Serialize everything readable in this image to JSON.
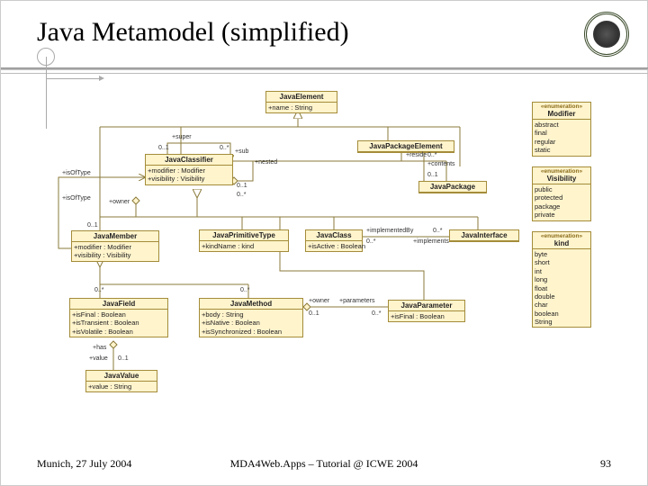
{
  "title": "Java Metamodel (simplified)",
  "footer": {
    "left": "Munich, 27 July 2004",
    "mid": "MDA4Web.Apps – Tutorial @ ICWE 2004",
    "page": "93"
  },
  "classes": {
    "JavaElement": {
      "name": "JavaElement",
      "attrs": "+name : String"
    },
    "JavaPackageElement": {
      "name": "JavaPackageElement"
    },
    "JavaClassifier": {
      "name": "JavaClassifier",
      "attrs": "+modifier : Modifier\n+visibility : Visibility"
    },
    "JavaPackage": {
      "name": "JavaPackage"
    },
    "JavaMember": {
      "name": "JavaMember",
      "attrs": "+modifier : Modifier\n+visibility : Visibility"
    },
    "JavaPrimitiveType": {
      "name": "JavaPrimitiveType",
      "attrs": "+kindName : kind"
    },
    "JavaClass": {
      "name": "JavaClass",
      "attrs": "+isActive : Boolean"
    },
    "JavaInterface": {
      "name": "JavaInterface"
    },
    "JavaField": {
      "name": "JavaField",
      "attrs": "+isFinal : Boolean\n+isTransient : Boolean\n+isVolatile : Boolean"
    },
    "JavaMethod": {
      "name": "JavaMethod",
      "attrs": "+body : String\n+isNative : Boolean\n+isSynchronized : Boolean"
    },
    "JavaParameter": {
      "name": "JavaParameter",
      "attrs": "+isFinal : Boolean"
    },
    "JavaValue": {
      "name": "JavaValue",
      "attrs": "+value : String"
    }
  },
  "enums": {
    "Modifier": {
      "stereo": "«enumeration»",
      "name": "Modifier",
      "lits": "abstract\nfinal\nregular\nstatic"
    },
    "Visibility": {
      "stereo": "«enumeration»",
      "name": "Visibility",
      "lits": "public\nprotected\npackage\nprivate"
    },
    "kind": {
      "stereo": "«enumeration»",
      "name": "kind",
      "lits": "byte\nshort\nint\nlong\nfloat\ndouble\nchar\nboolean\nString"
    }
  },
  "labels": {
    "super": "+super",
    "sub": "+sub",
    "zeroOne_a": "0..1",
    "zeroStar_a": "0..*",
    "nested": "+nested",
    "isOfType1": "+isOfType",
    "isOfType2": "+isOfType",
    "reside": "+reside",
    "contents": "+contents",
    "zeroStar_b": "0..*",
    "zeroOne_b": "0..1",
    "owner": "+owner",
    "implementedBy": "+implementedBy",
    "implements": "+implements",
    "zs_impl1": "0..*",
    "zs_impl2": "0..*",
    "zeroOne_c": "0..1",
    "zeroStar_c": "0..*",
    "zeroStar_d": "0..*",
    "zeroStar_e": "0..*",
    "ownerM": "+owner",
    "paramsRole": "+parameters",
    "zeroOne_p": "0..1",
    "zeroStar_p": "0..*",
    "has": "+has",
    "value": "+value",
    "zeroOne_v": "0..1"
  }
}
